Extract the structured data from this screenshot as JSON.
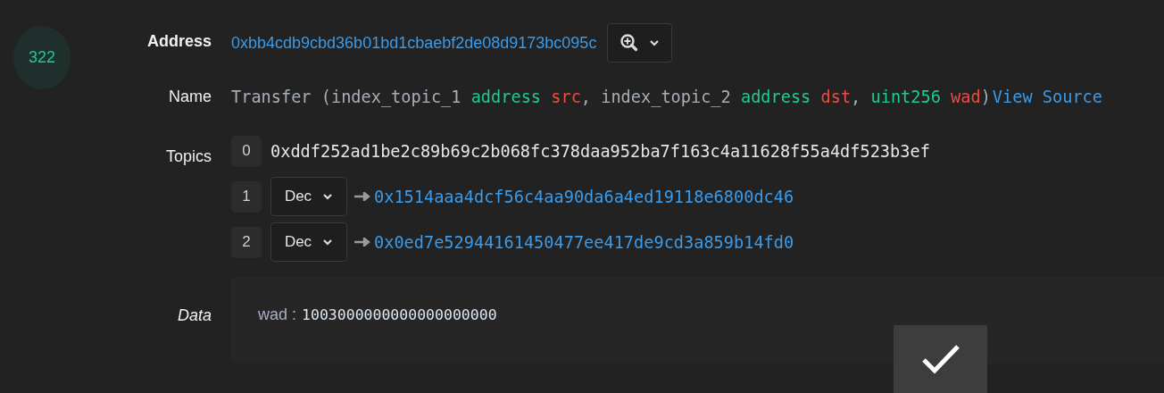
{
  "log_index": "322",
  "address": {
    "label": "Address",
    "value": "0xbb4cdb9cbd36b01bd1cbaebf2de08d9173bc095c"
  },
  "name": {
    "label": "Name",
    "tokens": [
      {
        "text": "Transfer (index_topic_1 ",
        "kind": "plain"
      },
      {
        "text": "address",
        "kind": "type"
      },
      {
        "text": " src",
        "kind": "param"
      },
      {
        "text": ", index_topic_2 ",
        "kind": "plain"
      },
      {
        "text": "address",
        "kind": "type"
      },
      {
        "text": " dst",
        "kind": "param"
      },
      {
        "text": ", ",
        "kind": "plain"
      },
      {
        "text": "uint256",
        "kind": "type"
      },
      {
        "text": " wad",
        "kind": "param"
      },
      {
        "text": ")",
        "kind": "plain"
      }
    ],
    "link": "View Source"
  },
  "topics": {
    "label": "Topics",
    "items": [
      {
        "index": "0",
        "kind": "raw",
        "value": "0xddf252ad1be2c89b69c2b068fc378daa952ba7f163c4a11628f55a4df523b3ef"
      },
      {
        "index": "1",
        "kind": "decoded",
        "format": "Dec",
        "value": "0x1514aaa4dcf56c4aa90da6a4ed19118e6800dc46"
      },
      {
        "index": "2",
        "kind": "decoded",
        "format": "Dec",
        "value": "0x0ed7e52944161450477ee417de9cd3a859b14fd0"
      }
    ]
  },
  "data": {
    "label": "Data",
    "key": "wad :",
    "value": "1003000000000000000000"
  }
}
